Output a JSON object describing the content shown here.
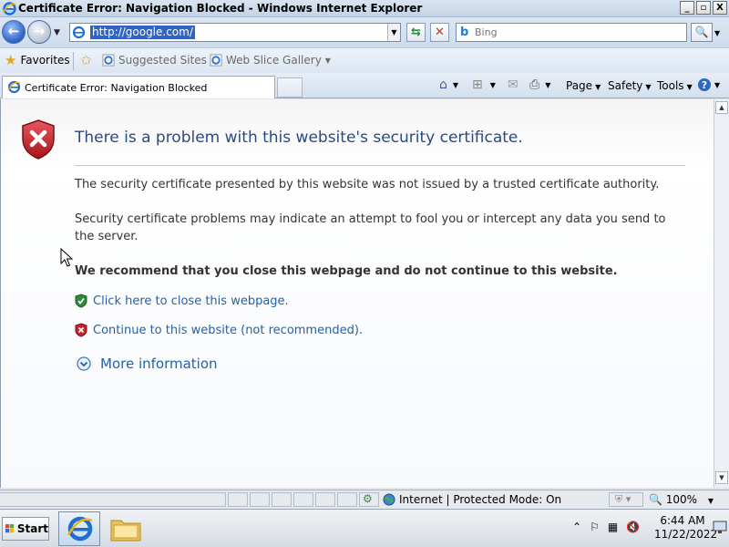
{
  "window": {
    "title": "Certificate Error: Navigation Blocked - Windows Internet Explorer",
    "controls": {
      "minimize": "_",
      "maximize": "▫",
      "close": "X"
    }
  },
  "address_bar": {
    "url": "http://google.com/",
    "search_placeholder": "Bing"
  },
  "favorites_bar": {
    "favorites_label": "Favorites",
    "items": [
      {
        "label": "Suggested Sites"
      },
      {
        "label": "Web Slice Gallery"
      }
    ]
  },
  "tab": {
    "label": "Certificate Error: Navigation Blocked"
  },
  "command_bar": {
    "page_label": "Page",
    "safety_label": "Safety",
    "tools_label": "Tools"
  },
  "page": {
    "heading": "There is a problem with this website's security certificate.",
    "para1": "The security certificate presented by this website was not issued by a trusted certificate authority.",
    "para2": "Security certificate problems may indicate an attempt to fool you or intercept any data you send to the server.",
    "recommendation": "We recommend that you close this webpage and do not continue to this website.",
    "close_link": "Click here to close this webpage.",
    "continue_link": "Continue to this website (not recommended).",
    "more_info": "More information"
  },
  "status_bar": {
    "zone": "Internet | Protected Mode: On",
    "zoom": "100%"
  },
  "taskbar": {
    "start_label": "Start",
    "time": "6:44 AM",
    "date": "11/22/2022"
  },
  "colors": {
    "link": "#2561a8",
    "heading": "#2a4a82",
    "shield_red": "#c8232c",
    "shield_green": "#2e8b3a"
  }
}
